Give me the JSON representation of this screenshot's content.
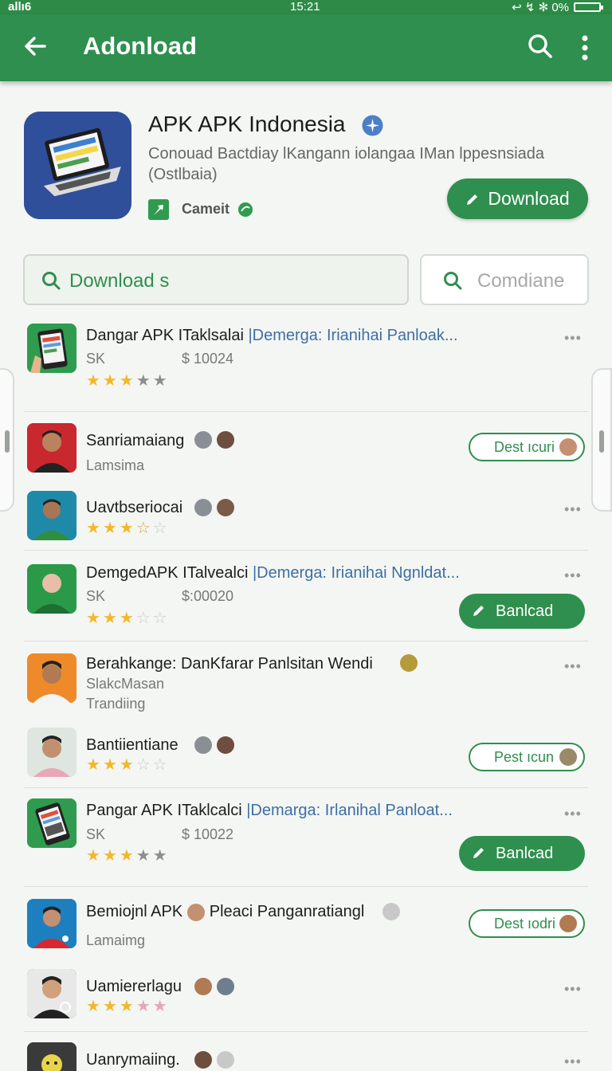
{
  "status_bar": {
    "signal": "allı6",
    "time": "15:21",
    "right": "↩ ↯ ✻ 0%"
  },
  "app_bar": {
    "title": "Adonload"
  },
  "hero": {
    "title": "APK APK Indonesia",
    "subtitle": "Conouad Bactdiay lKangann iolangaa IMan lppesnsiada (Ostlbaia)",
    "publisher": "Cameit",
    "button": "Download"
  },
  "search": {
    "value": "Download s"
  },
  "filter": {
    "placeholder": "Comdiane"
  },
  "colors": {
    "brand_green": "#2f8f4e",
    "link_blue": "#3d6fa4",
    "star_gold": "#f3b829"
  },
  "rows": [
    {
      "title": "Dangar APK ITaklsalai ",
      "title_hl": "|Demerga: Irianihai Panloak...",
      "meta": "SK",
      "price": "$ 10024",
      "stars": [
        "full",
        "full",
        "full",
        "grey",
        "grey"
      ]
    },
    {
      "title": "Sanriamaiang",
      "meta": "Lamsima",
      "button": "Dest ıcuri"
    },
    {
      "title": "Uavtbseriocai",
      "stars": [
        "full",
        "full",
        "full",
        "half",
        "empty"
      ]
    },
    {
      "title": "DemgedAPK ITalvealci ",
      "title_hl": "|Demerga: Irianihai Ngnldat...",
      "meta": "SK",
      "price": "$:00020",
      "stars": [
        "full",
        "full",
        "full",
        "empty",
        "empty"
      ],
      "button": "Banlcad"
    },
    {
      "title": "Berahkange: DanKfarar Panlsitan Wendi",
      "meta": "SlakcMasan",
      "meta2": "Trandiing"
    },
    {
      "title": "Bantiientiane",
      "stars": [
        "full",
        "full",
        "full",
        "empty",
        "empty"
      ],
      "button": "Pest ıcun"
    },
    {
      "title": "Pangar APK ITaklcalci ",
      "title_hl": "|Demarga: Irlanihal Panloat...",
      "meta": "SK",
      "price": "$ 10022",
      "stars": [
        "full",
        "full",
        "full",
        "grey",
        "grey"
      ],
      "button": "Banlcad"
    },
    {
      "title": "Bemiojnl APK ",
      "title2": "Pleaci Panganratiangl",
      "meta": "Lamaimg",
      "button": "Dest ıodri"
    },
    {
      "title": "Uamiererlagu",
      "stars": [
        "full",
        "full",
        "full",
        "pink",
        "pink"
      ]
    },
    {
      "title": "Uanrymaiing."
    }
  ]
}
